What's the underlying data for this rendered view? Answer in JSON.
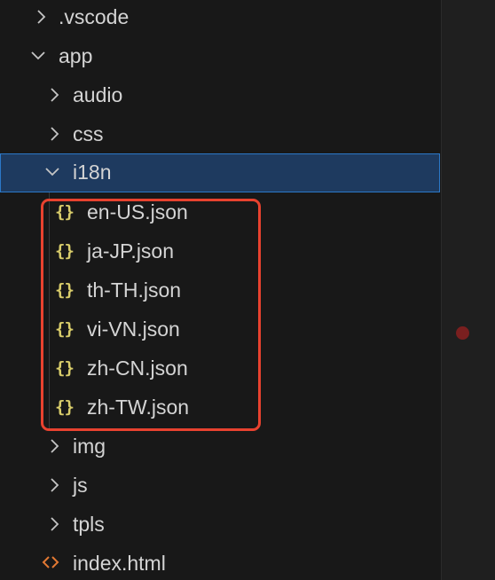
{
  "tree": {
    "root_items": [
      {
        "label": ".vscode",
        "icon": "chevron-right-icon"
      },
      {
        "label": "app",
        "icon": "chevron-down-icon"
      }
    ],
    "app_children": [
      {
        "label": "audio",
        "icon": "chevron-right-icon"
      },
      {
        "label": "css",
        "icon": "chevron-right-icon"
      },
      {
        "label": "i18n",
        "icon": "chevron-down-icon",
        "selected": true
      }
    ],
    "i18n_files": [
      {
        "label": "en-US.json",
        "icon": "json-braces-icon"
      },
      {
        "label": "ja-JP.json",
        "icon": "json-braces-icon"
      },
      {
        "label": "th-TH.json",
        "icon": "json-braces-icon"
      },
      {
        "label": "vi-VN.json",
        "icon": "json-braces-icon"
      },
      {
        "label": "zh-CN.json",
        "icon": "json-braces-icon"
      },
      {
        "label": "zh-TW.json",
        "icon": "json-braces-icon"
      }
    ],
    "app_rest": [
      {
        "label": "img",
        "icon": "chevron-right-icon"
      },
      {
        "label": "js",
        "icon": "chevron-right-icon"
      },
      {
        "label": "tpls",
        "icon": "chevron-right-icon"
      },
      {
        "label": "index.html",
        "icon": "html-file-icon"
      }
    ]
  },
  "icons": {
    "json_glyph": "{}"
  },
  "colors": {
    "background": "#181818",
    "selection_bg": "#1e3a5f",
    "selection_border": "#2b78c8",
    "json_icon": "#d8cc6a",
    "html_icon": "#e37933",
    "highlight_box": "#e8422f",
    "text": "#d4d4d4"
  }
}
